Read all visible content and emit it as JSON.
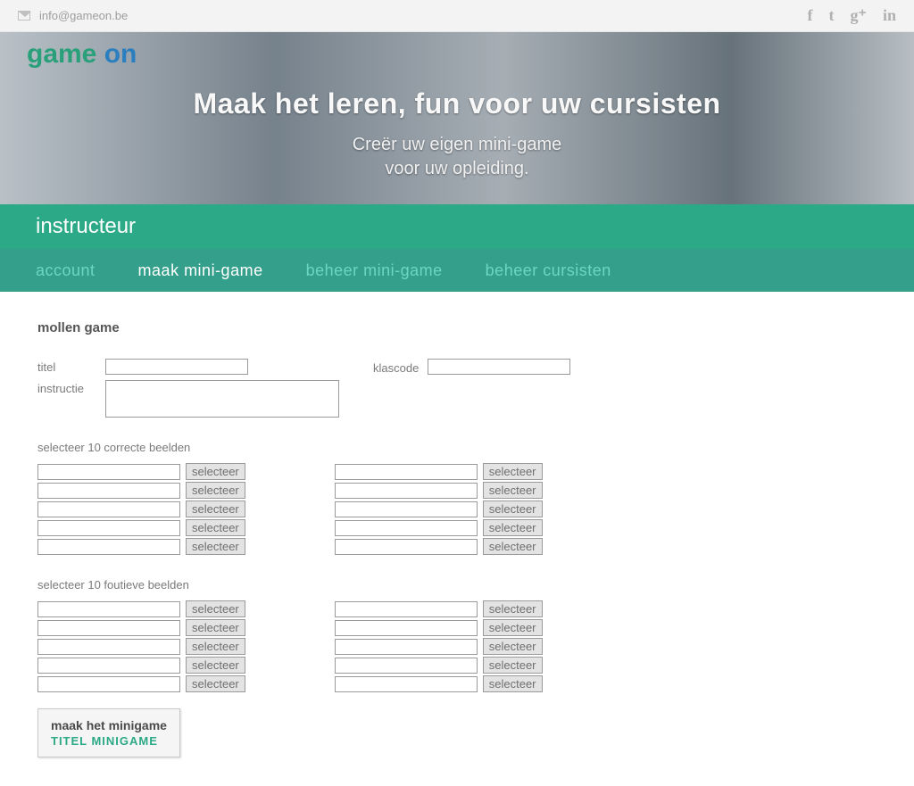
{
  "topbar": {
    "email": "info@gameon.be"
  },
  "logo": {
    "word1": "game",
    "word2": "on"
  },
  "hero": {
    "headline": "Maak het leren, fun voor uw cursisten",
    "sub1": "Creër uw eigen mini-game",
    "sub2": "voor uw opleiding."
  },
  "role_bar": {
    "title": "instructeur"
  },
  "nav": {
    "account": "account",
    "make": "maak mini-game",
    "manage_game": "beheer mini-game",
    "manage_students": "beheer cursisten"
  },
  "form": {
    "section_title": "mollen game",
    "label_title": "titel",
    "label_classcode": "klascode",
    "label_instruction": "instructie",
    "heading_correct": "selecteer 10 correcte beelden",
    "heading_wrong": "selecteer 10 foutieve beelden",
    "select_label": "selecteer"
  },
  "make_button": {
    "line1": "maak het minigame",
    "line2": "TITEL MINIGAME"
  }
}
